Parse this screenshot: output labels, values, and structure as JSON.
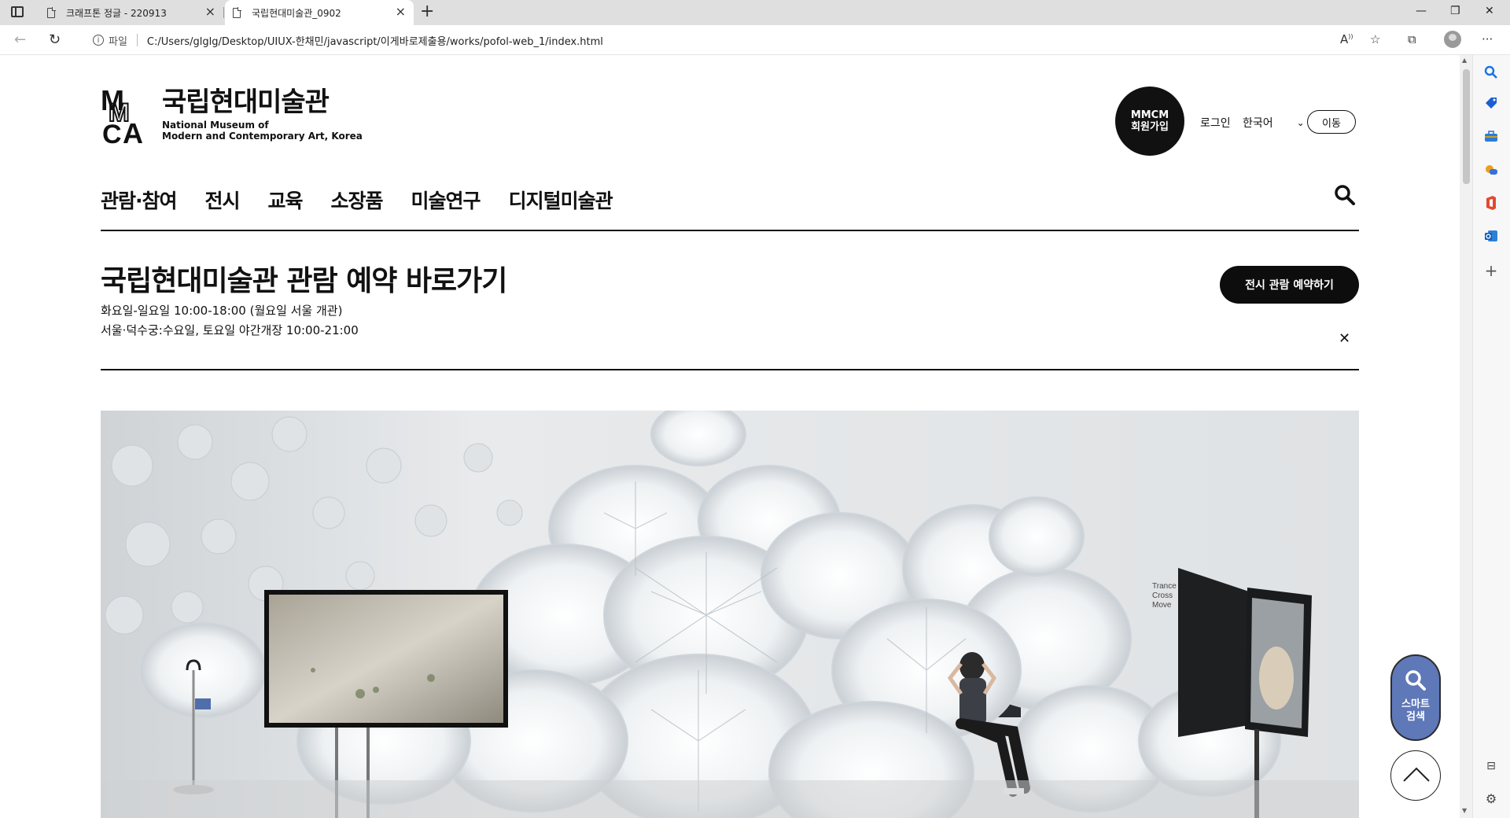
{
  "browser": {
    "tabs": [
      {
        "title": "크래프톤 정글 - 220913",
        "active": false
      },
      {
        "title": "국립현대미술관_0902",
        "active": true
      }
    ],
    "address": {
      "protocol_label": "파일",
      "url": "C:/Users/glglg/Desktop/UIUX-한채민/javascript/이게바로제출용/works/pofol-web_1/index.html"
    }
  },
  "header": {
    "logo_ko": "국립현대미술관",
    "logo_en_line1": "National Museum of",
    "logo_en_line2": "Modern and Contemporary Art, Korea",
    "join_line1": "MMCM",
    "join_line2": "회원가입",
    "login": "로그인",
    "language": "한국어",
    "move": "이동"
  },
  "gnb": {
    "items": [
      {
        "label": "관람·참여"
      },
      {
        "label": "전시"
      },
      {
        "label": "교육"
      },
      {
        "label": "소장품"
      },
      {
        "label": "미술연구"
      },
      {
        "label": "디지털미술관"
      }
    ]
  },
  "notice": {
    "title": "국립현대미술관 관람 예약 바로가기",
    "line1": "화요일-일요일 10:00-18:00 (월요일 서울 개관)",
    "line2": "서울·덕수궁:수요일, 토요일 야간개장 10:00-21:00",
    "button": "전시 관람 예약하기",
    "close": "✕"
  },
  "hero": {
    "wall_text": [
      "Trance",
      "Cross",
      "Move"
    ]
  },
  "floating": {
    "smart_search_line1": "스마트",
    "smart_search_line2": "검색"
  },
  "colors": {
    "smart_search_bg": "#5e78b8",
    "reserve_button_bg": "#0d0d0d",
    "edge_search_icon": "#1a73e8"
  }
}
